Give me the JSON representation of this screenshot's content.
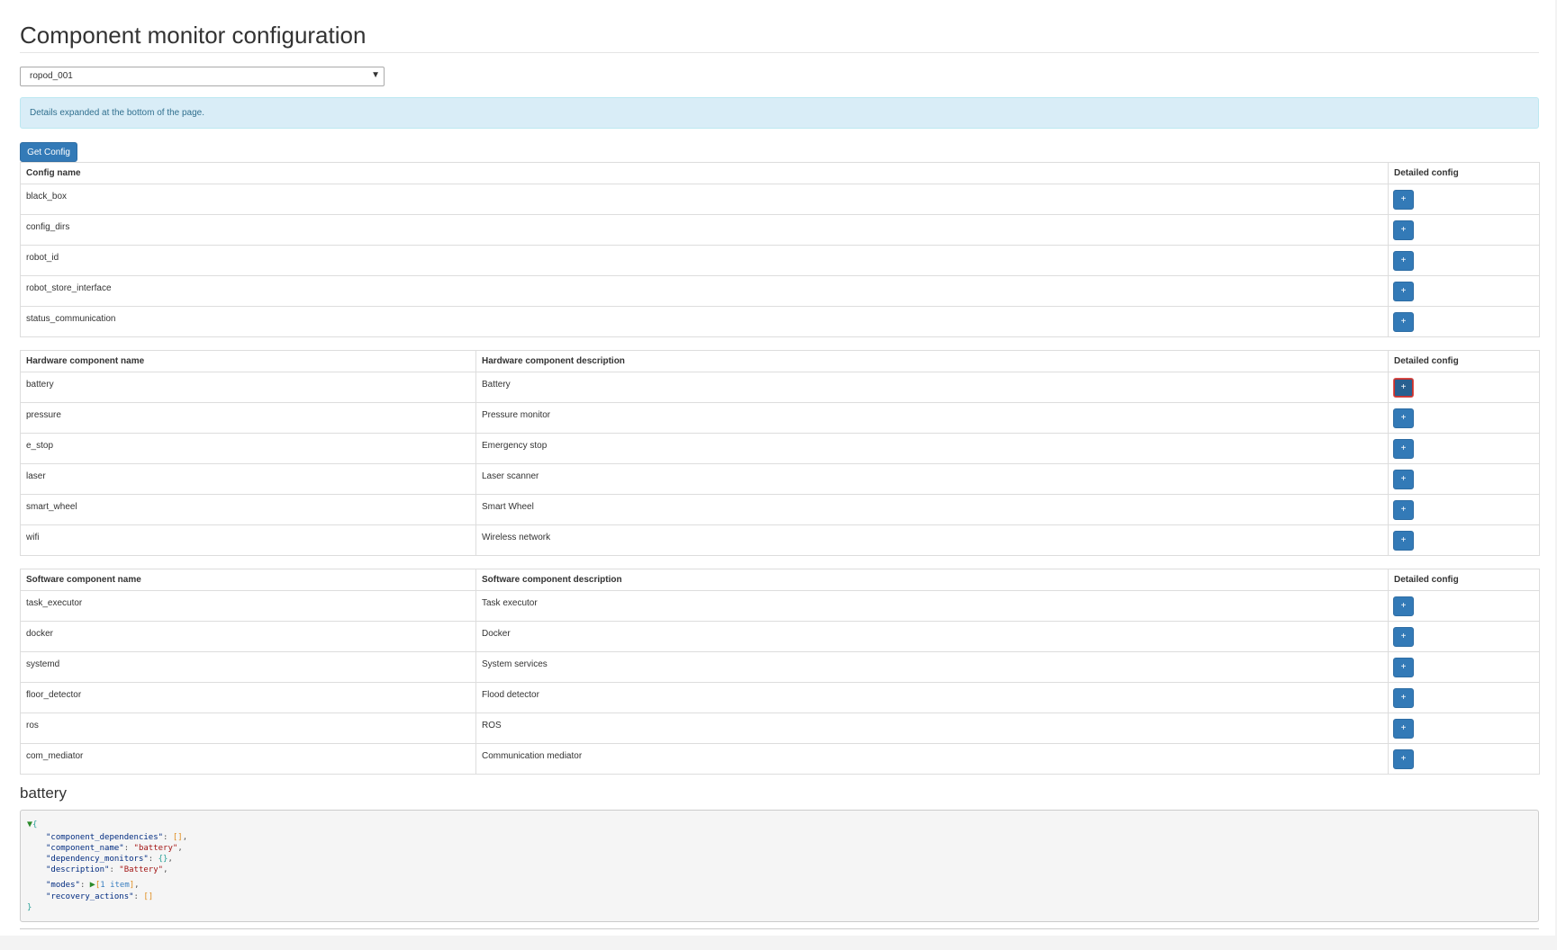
{
  "page": {
    "title": "Component monitor configuration"
  },
  "robot_select": {
    "value": "ropod_001"
  },
  "alert": {
    "text": "Details expanded at the bottom of the page."
  },
  "get_config_label": "Get Config",
  "config_table": {
    "headers": [
      "Config name",
      "Detailed config"
    ],
    "rows": [
      {
        "name": "black_box"
      },
      {
        "name": "config_dirs"
      },
      {
        "name": "robot_id"
      },
      {
        "name": "robot_store_interface"
      },
      {
        "name": "status_communication"
      }
    ]
  },
  "hardware_table": {
    "headers": [
      "Hardware component name",
      "Hardware component description",
      "Detailed config"
    ],
    "rows": [
      {
        "name": "battery",
        "description": "Battery"
      },
      {
        "name": "pressure",
        "description": "Pressure monitor"
      },
      {
        "name": "e_stop",
        "description": "Emergency stop"
      },
      {
        "name": "laser",
        "description": "Laser scanner"
      },
      {
        "name": "smart_wheel",
        "description": "Smart Wheel"
      },
      {
        "name": "wifi",
        "description": "Wireless network"
      }
    ]
  },
  "software_table": {
    "headers": [
      "Software component name",
      "Software component description",
      "Detailed config"
    ],
    "rows": [
      {
        "name": "task_executor",
        "description": "Task executor"
      },
      {
        "name": "docker",
        "description": "Docker"
      },
      {
        "name": "systemd",
        "description": "System services"
      },
      {
        "name": "floor_detector",
        "description": "Flood detector"
      },
      {
        "name": "ros",
        "description": "ROS"
      },
      {
        "name": "com_mediator",
        "description": "Communication mediator"
      }
    ]
  },
  "plus_label": "+",
  "detail": {
    "heading": "battery",
    "open_brace": "{",
    "close_brace": "}",
    "keys": {
      "component_dependencies": "\"component_dependencies\"",
      "component_name": "\"component_name\"",
      "dependency_monitors": "\"dependency_monitors\"",
      "description": "\"description\"",
      "modes": "\"modes\"",
      "recovery_actions": "\"recovery_actions\""
    },
    "values": {
      "component_dependencies": "[]",
      "component_name": "\"battery\"",
      "dependency_monitors": "{}",
      "description": "\"Battery\"",
      "modes_open": "[",
      "modes_count": "1 item",
      "modes_close": "]",
      "recovery_actions": "[]"
    }
  },
  "colors": {
    "primary": "#337ab7",
    "alert_bg": "#d9edf7",
    "alert_text": "#31708f",
    "json_key": "#002b80",
    "json_string": "#a31515"
  }
}
